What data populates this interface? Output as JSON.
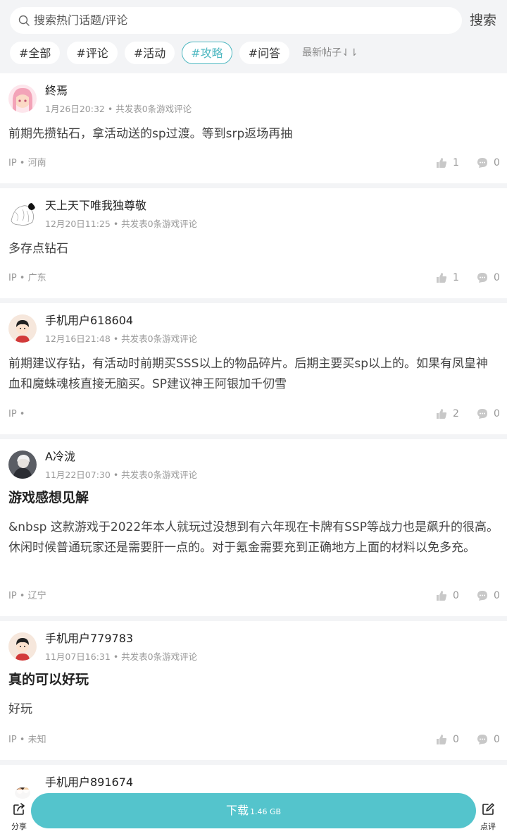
{
  "search": {
    "placeholder": "搜索热门话题/评论",
    "button": "搜索"
  },
  "tags": [
    "#全部",
    "#评论",
    "#活动",
    "#攻略",
    "#问答"
  ],
  "active_tag": "#攻略",
  "sort_label": "最新帖子⇃⇂",
  "posts": [
    {
      "name": "終焉",
      "date": "1月26日20:32",
      "sub": "共发表0条游戏评论",
      "title": "",
      "content": "前期先攒钻石，拿活动送的sp过渡。等到srp返场再抽",
      "ip": "IP • 河南",
      "likes": "1",
      "comments": "0"
    },
    {
      "name": "天上天下唯我独尊敬",
      "date": "12月20日11:25",
      "sub": "共发表0条游戏评论",
      "title": "",
      "content": "多存点钻石",
      "ip": "IP • 广东",
      "likes": "1",
      "comments": "0"
    },
    {
      "name": "手机用户618604",
      "date": "12月16日21:48",
      "sub": "共发表0条游戏评论",
      "title": "",
      "content": "前期建议存钻，有活动时前期买SSS以上的物品碎片。后期主要买sp以上的。如果有凤皇神血和魔蛛魂核直接无脑买。SP建议神王阿银加千仞雪",
      "ip": "IP •",
      "likes": "2",
      "comments": "0"
    },
    {
      "name": "A冷泷",
      "date": "11月22日07:30",
      "sub": "共发表0条游戏评论",
      "title": "游戏感想见解",
      "content": "&nbsp 这款游戏于2022年本人就玩过没想到有六年现在卡牌有SSP等战力也是飙升的很高。休闲时候普通玩家还是需要肝一点的。对于氪金需要充到正确地方上面的材料以免多充。",
      "ip": "IP • 辽宁",
      "likes": "0",
      "comments": "0"
    },
    {
      "name": "手机用户779783",
      "date": "11月07日16:31",
      "sub": "共发表0条游戏评论",
      "title": "真的可以好玩",
      "content": "好玩",
      "ip": "IP • 未知",
      "likes": "0",
      "comments": "0"
    },
    {
      "name": "手机用户891674"
    }
  ],
  "bottom": {
    "share_label": "分享",
    "download_label": "下载",
    "download_size": "1.46 GB",
    "review_label": "点评"
  },
  "colors": {
    "accent": "#54c4cc",
    "tag_active": "#4fb8c1",
    "background": "#f3f4f6"
  }
}
